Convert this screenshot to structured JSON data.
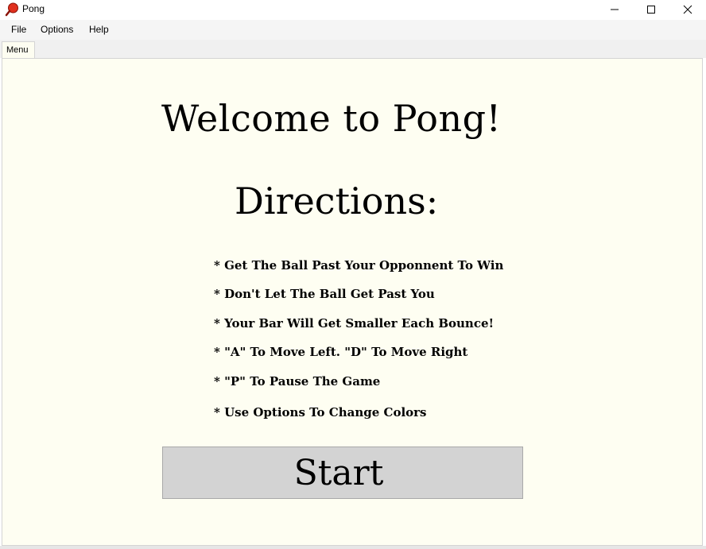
{
  "window": {
    "title": "Pong",
    "icon": "paddle-icon",
    "controls": [
      "minimize-icon",
      "maximize-icon",
      "close-icon"
    ]
  },
  "menubar": {
    "items": [
      {
        "label": "File"
      },
      {
        "label": "Options"
      },
      {
        "label": "Help"
      }
    ]
  },
  "tabs": [
    {
      "label": "Menu",
      "active": true
    }
  ],
  "main": {
    "welcome": "Welcome to Pong!",
    "directions_heading": "Directions:",
    "directions": [
      "* Get The Ball Past Your Opponnent To Win",
      "* Don't Let The Ball Get Past You",
      "* Your Bar Will Get Smaller Each Bounce!",
      "* \"A\" To Move Left. \"D\" To Move Right",
      "* \"P\" To Pause The Game",
      "* Use Options To Change Colors"
    ],
    "start_label": "Start"
  },
  "colors": {
    "panel_background": "#fefef2",
    "button_background": "#d3d3d3",
    "icon_red": "#e0301e"
  }
}
